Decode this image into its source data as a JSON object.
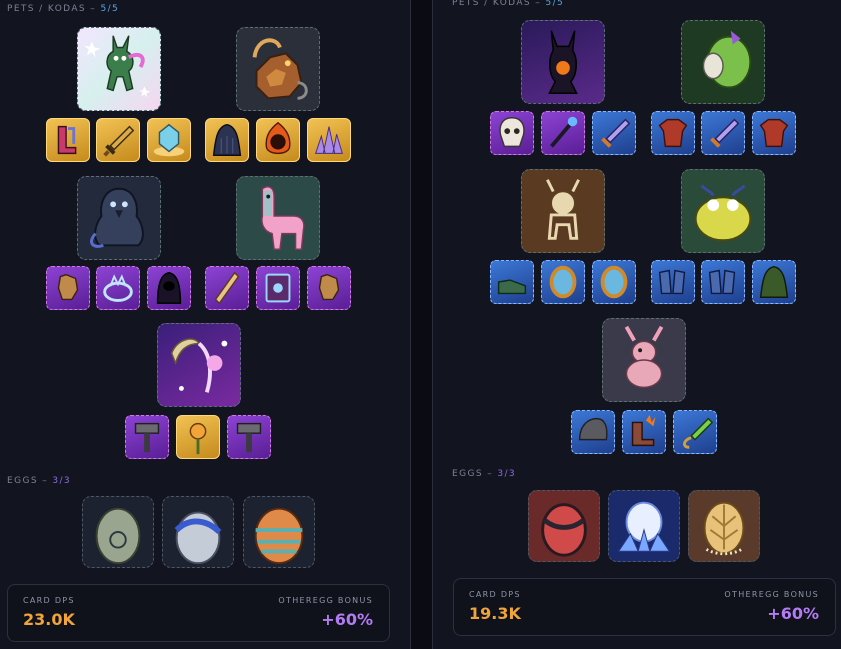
{
  "colors": {
    "background": "#12141f",
    "dps_value": "#f0a43a",
    "bonus_value": "#b37bf2",
    "pets_count": "#5aa5de",
    "eggs_count": "#8f6ae0",
    "item_gold": "#e0a83a",
    "item_purple": "#7a35c4",
    "item_blue": "#2f5fb8"
  },
  "left": {
    "pets_label": "PETS / KODAS –",
    "pets_count": "5/5",
    "eggs_label": "EGGS –",
    "eggs_count": "3/3",
    "stats": {
      "dps_label": "CARD DPS",
      "dps_value": "23.0K",
      "bonus_label": "OTHEREGG BONUS",
      "bonus_value": "+60%"
    }
  },
  "right": {
    "pets_label": "PETS / KODAS –",
    "pets_count": "5/5",
    "eggs_label": "EGGS –",
    "eggs_count": "3/3",
    "stats": {
      "dps_label": "CARD DPS",
      "dps_value": "19.3K",
      "bonus_label": "OTHEREGG BONUS",
      "bonus_value": "+60%"
    }
  }
}
